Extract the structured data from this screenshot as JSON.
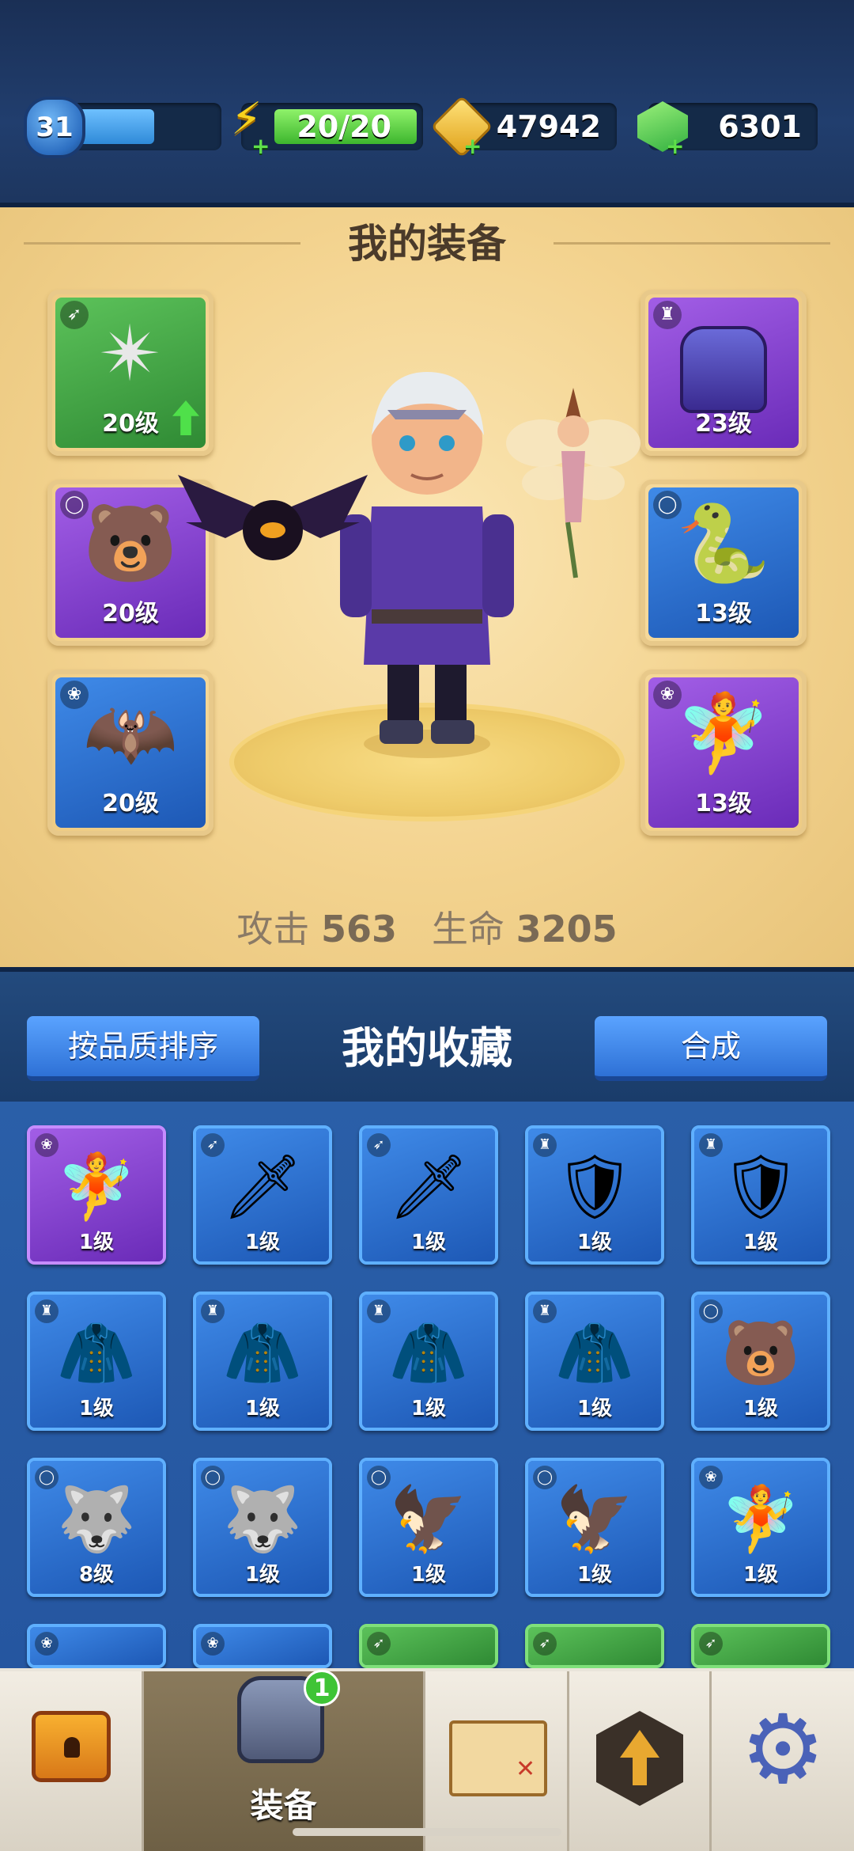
{
  "top_bar": {
    "level": "31",
    "energy": "20/20",
    "coins": "47942",
    "gems": "6301",
    "level_progress": 0.58,
    "icons": {
      "energy": "lightning-icon",
      "coins": "arrow-coin-icon",
      "gems": "gem-icon"
    }
  },
  "equipment": {
    "title": "我的装备",
    "left_slots": [
      {
        "level": "20级",
        "rarity": "green",
        "type_icon": "bow-icon",
        "item_icon": "shuriken-icon",
        "upgradable": true
      },
      {
        "level": "20级",
        "rarity": "purple",
        "type_icon": "ring-icon",
        "item_icon": "bear-ring-icon"
      },
      {
        "level": "20级",
        "rarity": "blue",
        "type_icon": "paw-icon",
        "item_icon": "bat-pet-icon"
      }
    ],
    "right_slots": [
      {
        "level": "23级",
        "rarity": "purple",
        "type_icon": "armor-icon",
        "item_icon": "purple-vest-icon"
      },
      {
        "level": "13级",
        "rarity": "blue",
        "type_icon": "ring-icon",
        "item_icon": "serpent-ring-icon"
      },
      {
        "level": "13级",
        "rarity": "purple",
        "type_icon": "paw-icon",
        "item_icon": "fairy-pet-icon"
      }
    ],
    "stats": {
      "attack_label": "攻击",
      "attack": "563",
      "hp_label": "生命",
      "hp": "3205"
    }
  },
  "collection": {
    "title": "我的收藏",
    "sort_button": "按品质排序",
    "merge_button": "合成",
    "items": [
      {
        "level": "1级",
        "rarity": "purple",
        "type_icon": "paw-icon",
        "item_icon": "fairy-pet-icon"
      },
      {
        "level": "1级",
        "rarity": "blue",
        "type_icon": "bow-icon",
        "item_icon": "sword-icon"
      },
      {
        "level": "1级",
        "rarity": "blue",
        "type_icon": "bow-icon",
        "item_icon": "sword-icon"
      },
      {
        "level": "1级",
        "rarity": "blue",
        "type_icon": "armor-icon",
        "item_icon": "gold-armor-icon"
      },
      {
        "level": "1级",
        "rarity": "blue",
        "type_icon": "armor-icon",
        "item_icon": "gold-armor-icon"
      },
      {
        "level": "1级",
        "rarity": "blue",
        "type_icon": "armor-icon",
        "item_icon": "dark-vest-icon"
      },
      {
        "level": "1级",
        "rarity": "blue",
        "type_icon": "armor-icon",
        "item_icon": "red-cape-icon"
      },
      {
        "level": "1级",
        "rarity": "blue",
        "type_icon": "armor-icon",
        "item_icon": "red-cape-icon"
      },
      {
        "level": "1级",
        "rarity": "blue",
        "type_icon": "armor-icon",
        "item_icon": "purple-vest-icon"
      },
      {
        "level": "1级",
        "rarity": "blue",
        "type_icon": "ring-icon",
        "item_icon": "bear-ring-icon"
      },
      {
        "level": "8级",
        "rarity": "blue",
        "type_icon": "ring-icon",
        "item_icon": "wolf-ring-icon"
      },
      {
        "level": "1级",
        "rarity": "blue",
        "type_icon": "ring-icon",
        "item_icon": "wolf-ring-icon"
      },
      {
        "level": "1级",
        "rarity": "blue",
        "type_icon": "ring-icon",
        "item_icon": "eagle-ring-icon"
      },
      {
        "level": "1级",
        "rarity": "blue",
        "type_icon": "ring-icon",
        "item_icon": "eagle-ring-icon"
      },
      {
        "level": "1级",
        "rarity": "blue",
        "type_icon": "paw-icon",
        "item_icon": "fairy-pet-icon"
      }
    ],
    "partial_row": [
      {
        "rarity": "blue",
        "type_icon": "paw-icon"
      },
      {
        "rarity": "blue",
        "type_icon": "paw-icon"
      },
      {
        "rarity": "green",
        "type_icon": "bow-icon"
      },
      {
        "rarity": "green",
        "type_icon": "bow-icon"
      },
      {
        "rarity": "green",
        "type_icon": "bow-icon"
      }
    ]
  },
  "nav": {
    "equip_label": "装备",
    "equip_badge": "1",
    "tabs": [
      "chest-icon",
      "armor-icon",
      "map-icon",
      "upgrade-arrow-icon",
      "gear-icon"
    ]
  }
}
